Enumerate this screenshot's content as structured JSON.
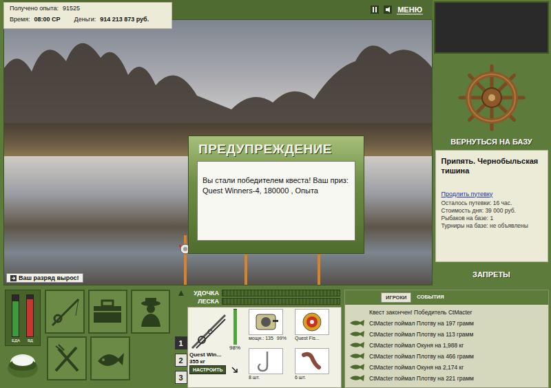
{
  "header": {
    "exp_label": "Получено опыта:",
    "exp": "91525",
    "time_label": "Время:",
    "time": "08:00 СР",
    "money_label": "Деньги:",
    "money": "914 213 873 руб."
  },
  "menu": "МЕНЮ",
  "dialog": {
    "title": "ПРЕДУПРЕЖДЕНИЕ",
    "message": "Вы стали победителем квеста! Ваш приз: Quest Winners-4, 180000 , Опыта"
  },
  "notice": "Ваш разряд вырос!",
  "base": {
    "return": "ВЕРНУТЬСЯ НА БАЗУ",
    "place": "Припять. Чернобыльская тишина",
    "extend": "Продлить путевку",
    "lines": [
      "Осталось путевки: 16 час.",
      "Стоимость дня: 39 000 руб.",
      "Рыбаков на базе: 1",
      "Турниры на базе: не объявлены"
    ],
    "bans": "ЗАПРЕТЫ"
  },
  "meters": [
    {
      "label": "ЕДА",
      "level": 0.85,
      "color": "#3f9a3a"
    },
    {
      "label": "ВД",
      "level": 0.9,
      "color": "#c8372e"
    }
  ],
  "pages": [
    {
      "label": "1",
      "selected": true
    },
    {
      "label": "2",
      "selected": false
    },
    {
      "label": "3",
      "selected": false
    }
  ],
  "gear_bars": [
    {
      "label": "УДОЧКА",
      "level": 0
    },
    {
      "label": "ЛЕСКА",
      "level": 0
    }
  ],
  "tackle": {
    "rod": {
      "name": "Quest Win...",
      "load": "355 кг",
      "condition": "98%",
      "level": 0.98,
      "button": "НАСТРОИТЬ"
    },
    "reel": {
      "power": "мощн.: 135",
      "condition": "99%"
    },
    "lure": {
      "name": "Quest Fis..."
    },
    "hook": {
      "count": "8 шт."
    },
    "bait": {
      "count": "6 шт."
    }
  },
  "log": {
    "tabs": [
      {
        "label": "ИГРОКИ",
        "selected": true
      },
      {
        "label": "СОБЫТИЯ",
        "selected": false
      }
    ],
    "entries": [
      {
        "text": "Квест закончен! Победитель CtMacter",
        "kind": "system"
      },
      {
        "text": "CtMacter поймал Плотву на 197 грамм",
        "kind": "catch"
      },
      {
        "text": "CtMacter поймал Плотву на 113 грамм",
        "kind": "catch"
      },
      {
        "text": "CtMacter поймал Окуня на 1,988 кг",
        "kind": "catch"
      },
      {
        "text": "CtMacter поймал Плотву на 466 грамм",
        "kind": "catch"
      },
      {
        "text": "CtMacter поймал Окуня на 2,174 кг",
        "kind": "catch"
      },
      {
        "text": "CtMacter поймал Плотву на 221 грамм",
        "kind": "catch"
      }
    ]
  }
}
